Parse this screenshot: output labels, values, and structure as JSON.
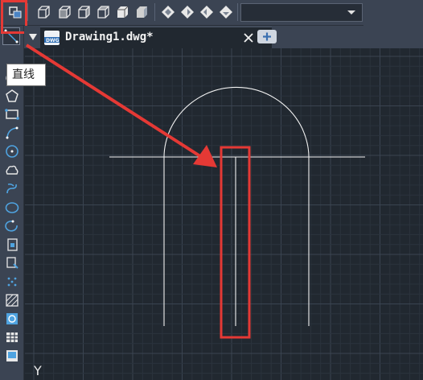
{
  "app": {
    "top_toolbar": {
      "buttons": [
        "layer-properties-icon",
        "cube-icon",
        "cube-icon",
        "cube-icon",
        "cube-icon",
        "cube-icon",
        "cube-icon",
        "view-cube-icon",
        "view-cube-icon",
        "view-cube-icon",
        "view-cube-icon"
      ],
      "layer_dropdown_value": ""
    },
    "left_toolbar": {
      "tools": [
        "line-icon",
        "polyline-icon",
        "polygon-icon",
        "rectangle-icon",
        "arc-icon",
        "circle-icon",
        "revision-cloud-icon",
        "spline-icon",
        "ellipse-icon",
        "ellipse-arc-icon",
        "insert-block-icon",
        "make-block-icon",
        "point-icon",
        "hatch-icon",
        "region-icon",
        "table-icon",
        "multiline-text-icon"
      ]
    },
    "tooltip": {
      "text": "直线"
    },
    "tab": {
      "title": "Drawing1.dwg*",
      "close": "✕",
      "new_tab": "+"
    },
    "canvas": {
      "background": "#212830",
      "axis_label": "Y",
      "highlight_color": "#e53935"
    }
  }
}
